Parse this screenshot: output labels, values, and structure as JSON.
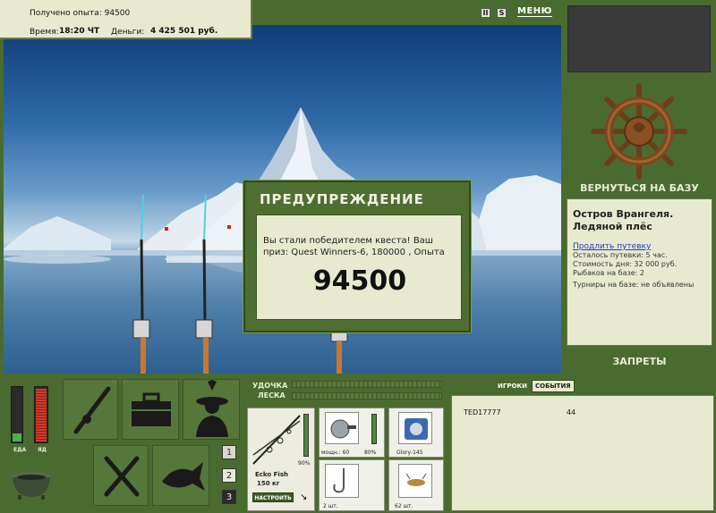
{
  "hud": {
    "exp_label": "Получено опыта:",
    "exp_value": "94500",
    "time_label": "Время:",
    "time_value": "18:20 ЧТ",
    "money_label": "Деньги:",
    "money_value": "4 425 501 руб."
  },
  "top": {
    "pause_symbol": "II",
    "sound_symbol": "S",
    "menu_label": "МЕНЮ"
  },
  "right_panel": {
    "return_label": "ВЕРНУТЬСЯ НА БАЗУ",
    "location_title_1": "Остров Врангеля.",
    "location_title_2": "Ледяной плёс",
    "extend_link": "Продлить путевку",
    "trip_left": "Осталось путевки: 5 час.",
    "day_cost": "Стоимость дня: 32 000 руб.",
    "fishers": "Рыбаков на базе: 2",
    "tournaments": "Турниры на базе: не объявлены",
    "bans_label": "ЗАПРЕТЫ"
  },
  "dialog": {
    "title": "ПРЕДУПРЕЖДЕНИЕ",
    "message": "Вы стали победителем квеста! Ваш приз: Quest Winners-6, 180000 , Опыта",
    "amount": "94500"
  },
  "status_bars": {
    "food_label": "ЕДА",
    "food_level": 0.15,
    "poison_label": "ЯД",
    "poison_level": 0.95
  },
  "number_buttons": [
    "1",
    "2",
    "3"
  ],
  "tackle": {
    "rod_label": "УДОЧКА",
    "line_label": "ЛЕСКА",
    "rod_name": "Ecko Fish",
    "rod_weight": "150 кг",
    "rod_pct": "90%",
    "reel_power": "мощн.: 60",
    "reel_pct": "80%",
    "line_name": "Glory-145",
    "hooks_count": "2 шт.",
    "bait_count": "62 шт.",
    "tune_label": "НАСТРОИТЬ"
  },
  "players_panel": {
    "tab_players": "ИГРОКИ",
    "tab_events": "СОБЫТИЯ",
    "rows": [
      {
        "name": "TED17777",
        "level": "44"
      }
    ]
  },
  "colors": {
    "panel_green": "#4a6b2f",
    "paper": "#e8ead0",
    "food_bar": "#4cb14a",
    "poison_bar": "#d23a2a"
  }
}
